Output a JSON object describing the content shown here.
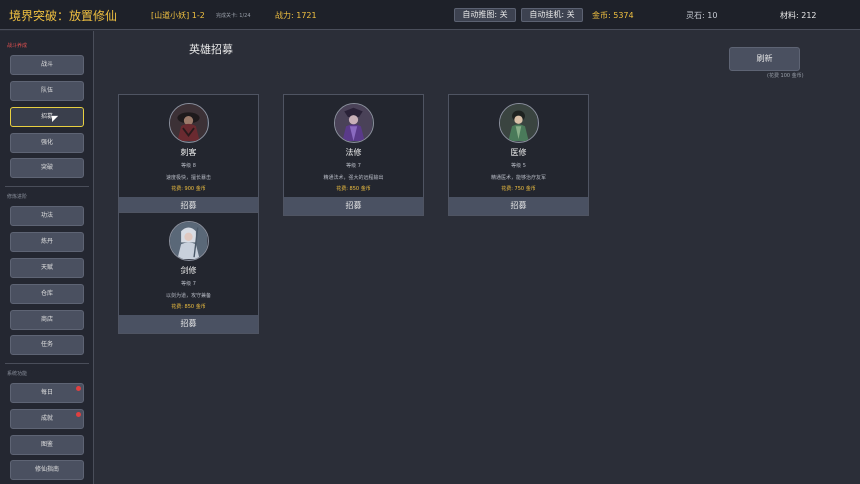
{
  "topbar": {
    "title": "境界突破：放置修仙",
    "stage": "[山道小妖] 1-2",
    "progress": "完成关卡: 1/24",
    "power": "战力: 1721",
    "auto_push": "自动推图: 关",
    "auto_idle": "自动挂机: 关",
    "gold": "金币: 5374",
    "spirit_stone": "灵石: 10",
    "material": "材料: 212"
  },
  "sidebar": {
    "section1": "战斗养成",
    "section2": "修炼进阶",
    "section3": "系统功能",
    "items": [
      {
        "label": "战斗"
      },
      {
        "label": "队伍"
      },
      {
        "label": "招募"
      },
      {
        "label": "强化"
      },
      {
        "label": "突破"
      },
      {
        "label": "功法"
      },
      {
        "label": "炼丹"
      },
      {
        "label": "天赋"
      },
      {
        "label": "仓库"
      },
      {
        "label": "商店"
      },
      {
        "label": "任务"
      },
      {
        "label": "每日"
      },
      {
        "label": "成就"
      },
      {
        "label": "图鉴"
      },
      {
        "label": "修仙指南"
      }
    ]
  },
  "main": {
    "title": "英雄招募",
    "refresh_label": "刷新",
    "refresh_cost": "(花费 100 金币)",
    "recruit_label": "招募",
    "heroes": [
      {
        "name": "刺客",
        "level": "等级 8",
        "desc": "速度极快，擅长暴击",
        "cost": "花费: 900 金币"
      },
      {
        "name": "法修",
        "level": "等级 7",
        "desc": "精通法术，强大的远程输出",
        "cost": "花费: 850 金币"
      },
      {
        "name": "医修",
        "level": "等级 5",
        "desc": "精通医术，能够治疗友军",
        "cost": "花费: 750 金币"
      },
      {
        "name": "剑修",
        "level": "等级 7",
        "desc": "以剑为道，攻守兼备",
        "cost": "花费: 850 金币"
      }
    ]
  },
  "colors": {
    "accent_gold": "#f0c040",
    "active_border": "#e8d040",
    "badge_red": "#e04040"
  }
}
